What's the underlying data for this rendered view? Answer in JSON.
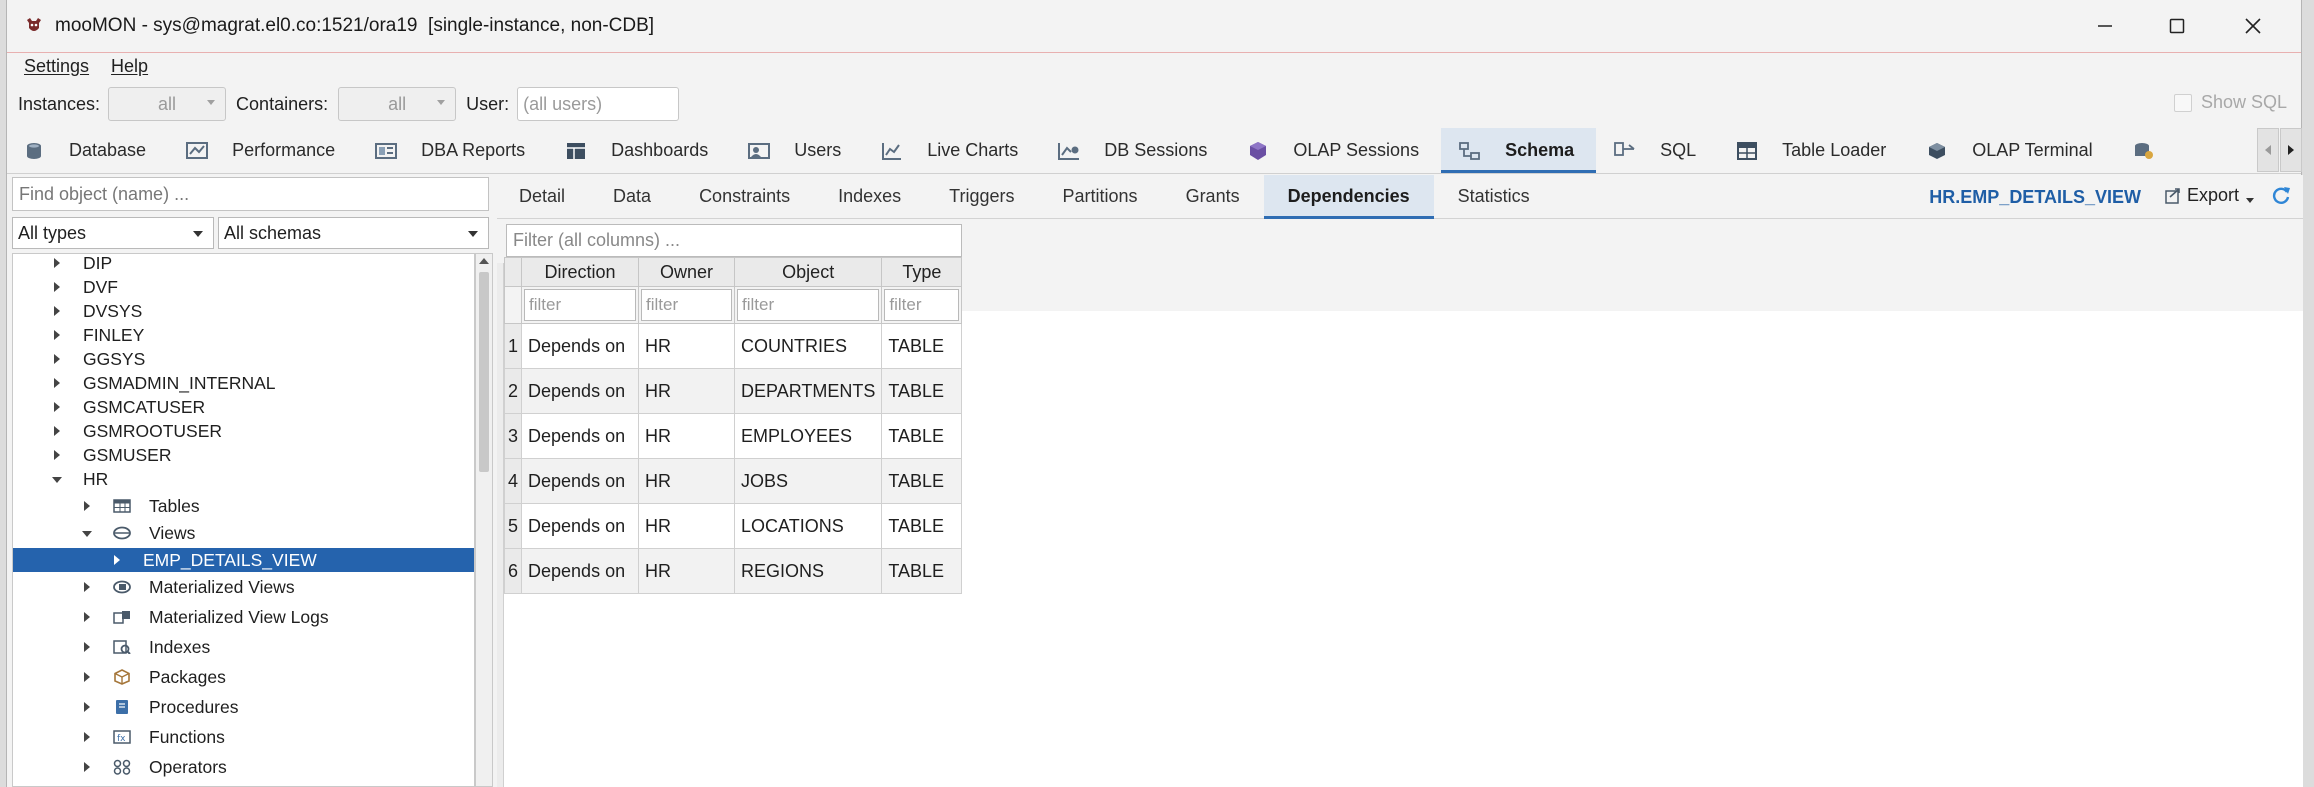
{
  "window": {
    "title": "mooMON - sys@magrat.el0.co:1521/ora19  [single-instance, non-CDB]"
  },
  "menu": {
    "settings": "Settings",
    "help": "Help"
  },
  "filters": {
    "instances_label": "Instances:",
    "instances_value": "all",
    "containers_label": "Containers:",
    "containers_value": "all",
    "user_label": "User:",
    "user_placeholder": "(all users)",
    "show_sql": "Show SQL"
  },
  "main_tabs": [
    {
      "label": "Database",
      "icon": "database-icon"
    },
    {
      "label": "Performance",
      "icon": "performance-icon"
    },
    {
      "label": "DBA Reports",
      "icon": "dba-reports-icon"
    },
    {
      "label": "Dashboards",
      "icon": "dashboards-icon"
    },
    {
      "label": "Users",
      "icon": "users-icon"
    },
    {
      "label": "Live Charts",
      "icon": "live-charts-icon"
    },
    {
      "label": "DB Sessions",
      "icon": "db-sessions-icon"
    },
    {
      "label": "OLAP Sessions",
      "icon": "olap-sessions-icon"
    },
    {
      "label": "Schema",
      "icon": "schema-icon",
      "active": true
    },
    {
      "label": "SQL",
      "icon": "sql-icon"
    },
    {
      "label": "Table Loader",
      "icon": "table-loader-icon"
    },
    {
      "label": "OLAP Terminal",
      "icon": "olap-terminal-icon"
    }
  ],
  "left_panel": {
    "find_placeholder": "Find object (name) ...",
    "type_select": "All types",
    "schema_select": "All schemas",
    "tree": [
      {
        "label": "DIP",
        "level": 0,
        "state": "collapsed"
      },
      {
        "label": "DVF",
        "level": 0,
        "state": "collapsed"
      },
      {
        "label": "DVSYS",
        "level": 0,
        "state": "collapsed"
      },
      {
        "label": "FINLEY",
        "level": 0,
        "state": "collapsed"
      },
      {
        "label": "GGSYS",
        "level": 0,
        "state": "collapsed"
      },
      {
        "label": "GSMADMIN_INTERNAL",
        "level": 0,
        "state": "collapsed"
      },
      {
        "label": "GSMCATUSER",
        "level": 0,
        "state": "collapsed"
      },
      {
        "label": "GSMROOTUSER",
        "level": 0,
        "state": "collapsed"
      },
      {
        "label": "GSMUSER",
        "level": 0,
        "state": "collapsed"
      },
      {
        "label": "HR",
        "level": 0,
        "state": "expanded"
      },
      {
        "label": "Tables",
        "level": 1,
        "state": "collapsed",
        "icon": "table-icon"
      },
      {
        "label": "Views",
        "level": 1,
        "state": "expanded",
        "icon": "view-icon"
      },
      {
        "label": "EMP_DETAILS_VIEW",
        "level": 2,
        "state": "collapsed",
        "selected": true
      },
      {
        "label": "Materialized Views",
        "level": 1,
        "state": "collapsed",
        "icon": "materialized-view-icon"
      },
      {
        "label": "Materialized View Logs",
        "level": 1,
        "state": "collapsed",
        "icon": "mview-log-icon"
      },
      {
        "label": "Indexes",
        "level": 1,
        "state": "collapsed",
        "icon": "index-icon"
      },
      {
        "label": "Packages",
        "level": 1,
        "state": "collapsed",
        "icon": "package-icon"
      },
      {
        "label": "Procedures",
        "level": 1,
        "state": "collapsed",
        "icon": "procedure-icon"
      },
      {
        "label": "Functions",
        "level": 1,
        "state": "collapsed",
        "icon": "function-icon"
      },
      {
        "label": "Operators",
        "level": 1,
        "state": "collapsed",
        "icon": "operator-icon"
      }
    ]
  },
  "sub_tabs": [
    "Detail",
    "Data",
    "Constraints",
    "Indexes",
    "Triggers",
    "Partitions",
    "Grants",
    "Dependencies",
    "Statistics"
  ],
  "active_sub_tab": "Dependencies",
  "object_name": "HR.EMP_DETAILS_VIEW",
  "export_label": "Export",
  "grid": {
    "filter_placeholder": "Filter (all columns) ...",
    "columns": [
      "Direction",
      "Owner",
      "Object",
      "Type"
    ],
    "column_filter_placeholder": "filter",
    "rows": [
      {
        "n": "1",
        "direction": "Depends on",
        "owner": "HR",
        "object": "COUNTRIES",
        "type": "TABLE"
      },
      {
        "n": "2",
        "direction": "Depends on",
        "owner": "HR",
        "object": "DEPARTMENTS",
        "type": "TABLE"
      },
      {
        "n": "3",
        "direction": "Depends on",
        "owner": "HR",
        "object": "EMPLOYEES",
        "type": "TABLE"
      },
      {
        "n": "4",
        "direction": "Depends on",
        "owner": "HR",
        "object": "JOBS",
        "type": "TABLE"
      },
      {
        "n": "5",
        "direction": "Depends on",
        "owner": "HR",
        "object": "LOCATIONS",
        "type": "TABLE"
      },
      {
        "n": "6",
        "direction": "Depends on",
        "owner": "HR",
        "object": "REGIONS",
        "type": "TABLE"
      }
    ]
  },
  "colors": {
    "accent": "#2f6db3",
    "selected_row": "#2563ad",
    "object_name": "#1f5ea6"
  }
}
